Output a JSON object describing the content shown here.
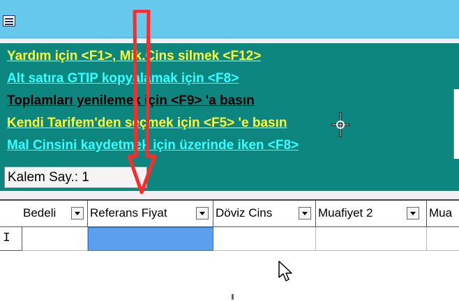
{
  "hints": {
    "line1": "Yardım için <F1>, Mik.Cins silmek <F12>",
    "line2": "Alt satıra GTIP kopyalamak için <F8>",
    "line3": "Toplamları yenilemek için <F9> 'a basın",
    "line4": "Kendi Tarifem'den seçmek  için <F5> 'e basın",
    "line5": "Mal Cinsini kaydetmek için üzerinde iken <F8>"
  },
  "kalem": {
    "label": "Kalem Say.: 1"
  },
  "grid": {
    "columns": [
      "Bedeli",
      "Referans Fiyat",
      "Döviz Cins",
      "Muafiyet 2",
      "Mua"
    ],
    "row_indicator": "I"
  },
  "colors": {
    "title_bar": "#66c8ea",
    "panel": "#0e8680",
    "yellow_text": "#ffff33",
    "cyan_text": "#33ffff",
    "selected_cell": "#5aa0ee",
    "annotation_arrow": "#ff2a2a"
  },
  "icons": [
    "app-window-icon",
    "dropdown-arrow-icon",
    "mouse-pointer-icon",
    "crosshair-cursor-icon",
    "red-down-arrow-annotation"
  ]
}
